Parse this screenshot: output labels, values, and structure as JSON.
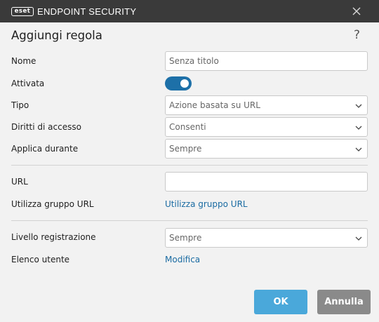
{
  "titlebar": {
    "logo": "eset",
    "app_name": "ENDPOINT SECURITY",
    "close_icon": "close-icon"
  },
  "dialog": {
    "title": "Aggiungi regola",
    "help": "?"
  },
  "form": {
    "name_label": "Nome",
    "name_placeholder": "Senza titolo",
    "enabled_label": "Attivata",
    "enabled_value": true,
    "type_label": "Tipo",
    "type_value": "Azione basata su URL",
    "access_label": "Diritti di accesso",
    "access_value": "Consenti",
    "apply_label": "Applica durante",
    "apply_value": "Sempre",
    "url_label": "URL",
    "url_value": "",
    "url_group_label": "Utilizza gruppo URL",
    "url_group_link": "Utilizza gruppo URL",
    "log_label": "Livello registrazione",
    "log_value": "Sempre",
    "users_label": "Elenco utente",
    "users_link": "Modifica"
  },
  "buttons": {
    "ok": "OK",
    "cancel": "Annulla"
  },
  "colors": {
    "titlebar": "#3a3a3a",
    "accent": "#1d70a8",
    "ok_button": "#4aa8da",
    "cancel_button": "#8a8a8a",
    "link": "#1a6ba2"
  }
}
